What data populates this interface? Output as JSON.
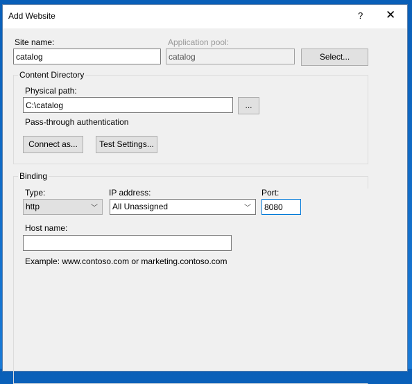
{
  "window": {
    "title": "Add Website",
    "help_label": "?",
    "close_label": "✕"
  },
  "site": {
    "site_name_label": "Site name:",
    "site_name_value": "catalog",
    "app_pool_label": "Application pool:",
    "app_pool_value": "catalog",
    "select_button": "Select..."
  },
  "content": {
    "legend": "Content Directory",
    "physical_path_label": "Physical path:",
    "physical_path_value": "C:\\catalog",
    "browse_button": "...",
    "pass_through_label": "Pass-through authentication",
    "connect_as_button": "Connect as...",
    "test_settings_button": "Test Settings..."
  },
  "binding": {
    "legend": "Binding",
    "type_label": "Type:",
    "type_value": "http",
    "ip_label": "IP address:",
    "ip_value": "All Unassigned",
    "port_label": "Port:",
    "port_value": "8080",
    "host_label": "Host name:",
    "host_value": "",
    "example": "Example: www.contoso.com or marketing.contoso.com"
  },
  "icons": {
    "dropdown": "chevron-down-icon"
  }
}
